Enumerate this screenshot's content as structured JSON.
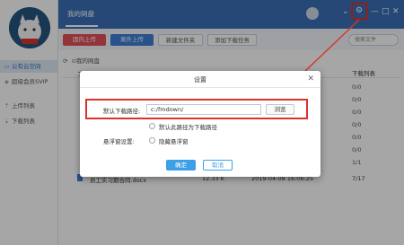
{
  "sidebar": {
    "items": [
      {
        "label": "公有云空间",
        "icon": "folder-icon",
        "active": true
      },
      {
        "label": "超级会员SVIP",
        "icon": "vip-icon",
        "active": false
      },
      {
        "label": "上传列表",
        "icon": "upload-icon",
        "active": false
      },
      {
        "label": "下载列表",
        "icon": "download-icon",
        "active": false
      }
    ]
  },
  "topbar": {
    "tab_label": "我的网盘"
  },
  "toolbar": {
    "buttons": [
      "国内上传",
      "离外上传",
      "新建文件夹",
      "添加下载任务"
    ],
    "search_placeholder": "搜索文件"
  },
  "filelist": {
    "breadcrumb": "我的网盘",
    "header_left": "文",
    "header_right": "下载列表",
    "right_col_values": [
      "0/0",
      "0/0",
      "0/0",
      "0/0",
      "0/0",
      "0/0",
      "1/1"
    ],
    "last_row": {
      "name": "员工实习期合同.docx",
      "size": "12.33 K",
      "date": "2019-04-08 16:06:25",
      "count": "7/17"
    }
  },
  "dialog": {
    "title": "设置",
    "path_label": "默认下载路径:",
    "path_value": "c:/fmdown/",
    "browse_label": "浏览",
    "default_path_checkbox": "默认此路径为下载路径",
    "tray_label": "悬浮窗设置:",
    "tray_checkbox": "隐藏悬浮窗",
    "ok_label": "确定",
    "cancel_label": "取消"
  },
  "colors": {
    "topbar": "#3b6fb5",
    "accent_red": "#d9342b",
    "ok_blue": "#3ca0e6"
  }
}
